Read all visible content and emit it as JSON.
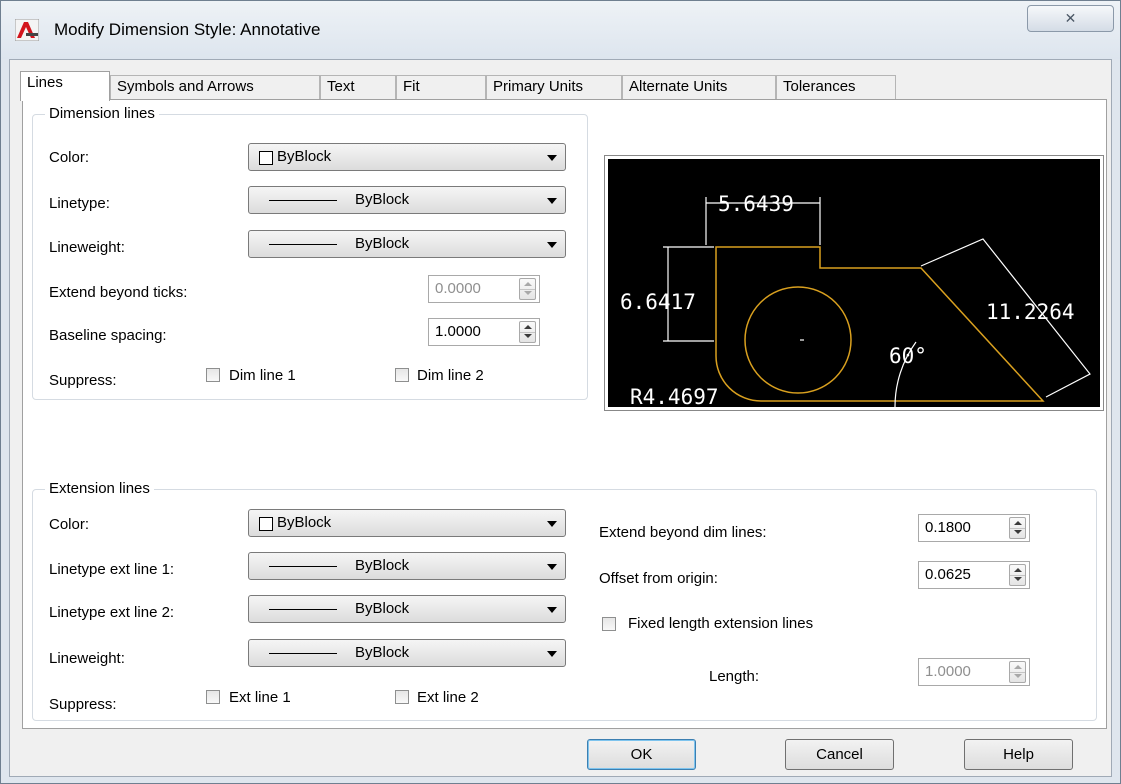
{
  "window": {
    "title": "Modify Dimension Style: Annotative",
    "close_glyph": "✕"
  },
  "tabs": [
    "Lines",
    "Symbols and Arrows",
    "Text",
    "Fit",
    "Primary Units",
    "Alternate Units",
    "Tolerances"
  ],
  "dimension_lines": {
    "title": "Dimension lines",
    "color_label": "Color:",
    "color_value": "ByBlock",
    "linetype_label": "Linetype:",
    "linetype_value": "ByBlock",
    "lineweight_label": "Lineweight:",
    "lineweight_value": "ByBlock",
    "extend_label": "Extend beyond ticks:",
    "extend_value": "0.0000",
    "baseline_label": "Baseline spacing:",
    "baseline_value": "1.0000",
    "suppress_label": "Suppress:",
    "dim_line1": "Dim line 1",
    "dim_line2": "Dim line 2"
  },
  "extension_lines": {
    "title": "Extension lines",
    "color_label": "Color:",
    "color_value": "ByBlock",
    "lt1_label": "Linetype ext line 1:",
    "lt1_value": "ByBlock",
    "lt2_label": "Linetype ext line 2:",
    "lt2_value": "ByBlock",
    "lineweight_label": "Lineweight:",
    "lineweight_value": "ByBlock",
    "suppress_label": "Suppress:",
    "ext_line1": "Ext line 1",
    "ext_line2": "Ext line 2",
    "extend_dim_label": "Extend beyond dim lines:",
    "extend_dim_value": "0.1800",
    "offset_label": "Offset from origin:",
    "offset_value": "0.0625",
    "fixed_label": "Fixed length extension lines",
    "length_label": "Length:",
    "length_value": "1.0000"
  },
  "preview": {
    "dim_top": "5.6439",
    "dim_left": "6.6417",
    "dim_right": "11.2264",
    "angle": "60°",
    "radius": "R4.4697",
    "colors": {
      "background": "#000000",
      "geometry": "#d9a01f",
      "dimensions": "#ffffff"
    }
  },
  "buttons": {
    "ok": "OK",
    "cancel": "Cancel",
    "help": "Help"
  }
}
